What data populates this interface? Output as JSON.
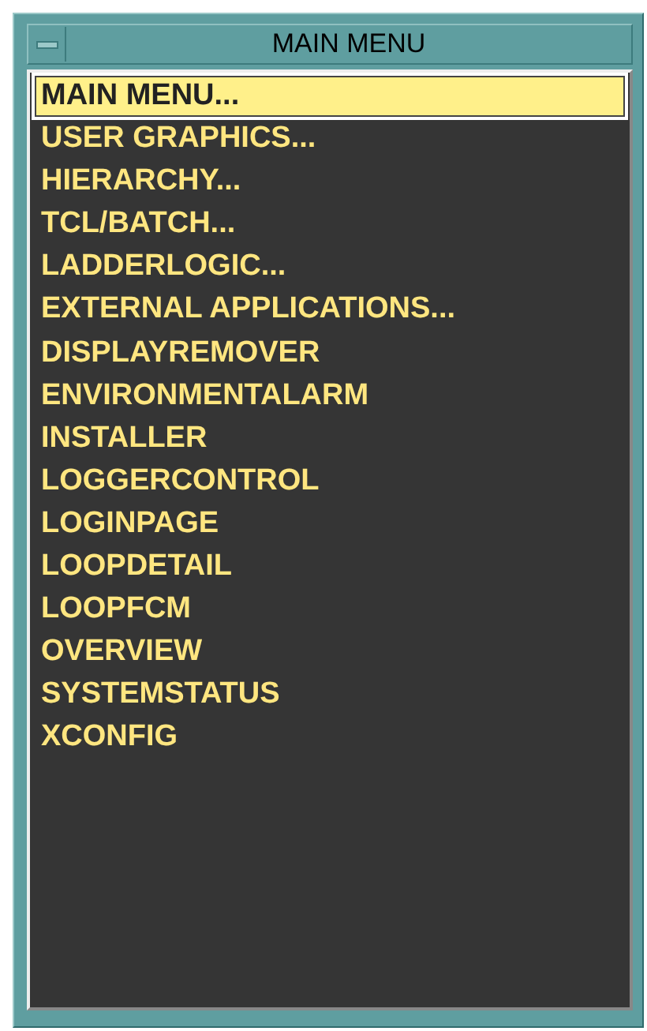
{
  "window": {
    "title": "MAIN MENU"
  },
  "menu_items": [
    {
      "label": "MAIN MENU...",
      "selected": true
    },
    {
      "label": "USER GRAPHICS...",
      "selected": false
    },
    {
      "label": "HIERARCHY...",
      "selected": false
    },
    {
      "label": "TCL/BATCH...",
      "selected": false
    },
    {
      "label": "LADDERLOGIC...",
      "selected": false
    },
    {
      "label": "EXTERNAL APPLICATIONS...",
      "selected": false
    },
    {
      "label": "DISPLAYREMOVER",
      "selected": false
    },
    {
      "label": "ENVIRONMENTALARM",
      "selected": false
    },
    {
      "label": "INSTALLER",
      "selected": false
    },
    {
      "label": "LOGGERCONTROL",
      "selected": false
    },
    {
      "label": "LOGINPAGE",
      "selected": false
    },
    {
      "label": "LOOPDETAIL",
      "selected": false
    },
    {
      "label": "LOOPFCM",
      "selected": false
    },
    {
      "label": "OVERVIEW",
      "selected": false
    },
    {
      "label": "SYSTEMSTATUS",
      "selected": false
    },
    {
      "label": "XCONFIG",
      "selected": false
    }
  ]
}
